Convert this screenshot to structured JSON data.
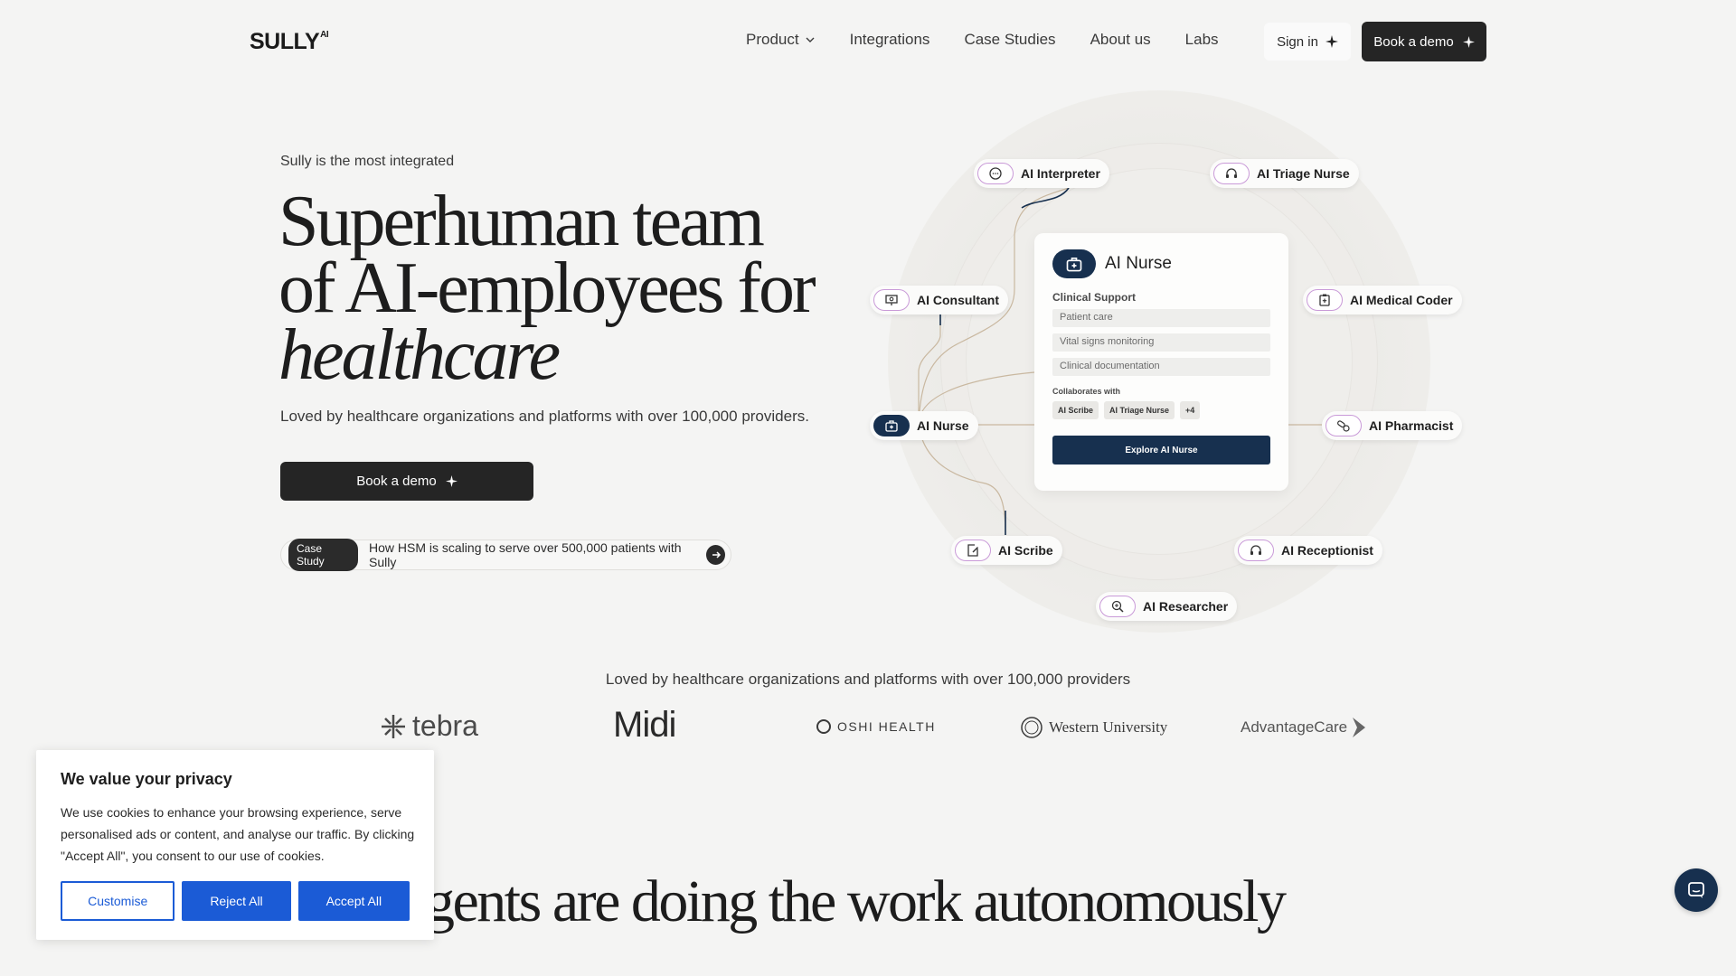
{
  "brand": {
    "logo_text": "SULLY",
    "logo_sup": "AI"
  },
  "nav": {
    "links": [
      "Product",
      "Integrations",
      "Case Studies",
      "About us",
      "Labs"
    ],
    "sign_in": "Sign in",
    "book_demo": "Book a demo"
  },
  "hero": {
    "eyebrow": "Sully is the most integrated",
    "headline_line1": "Superhuman team",
    "headline_line2": "of AI-employees for",
    "headline_line3": "healthcare",
    "subline": "Loved by healthcare organizations and platforms with over 100,000 providers.",
    "cta": "Book a demo",
    "case_badge": "Case Study",
    "case_text": "How HSM is scaling to serve over 500,000 patients with Sully"
  },
  "agents": {
    "interpreter": "AI Interpreter",
    "triage": "AI Triage Nurse",
    "consultant": "AI Consultant",
    "medical_coder": "AI Medical Coder",
    "nurse": "AI Nurse",
    "pharmacist": "AI Pharmacist",
    "scribe": "AI Scribe",
    "receptionist": "AI Receptionist",
    "researcher": "AI Researcher"
  },
  "nurse_card": {
    "title": "AI Nurse",
    "section_label": "Clinical Support",
    "items": [
      "Patient care",
      "Vital signs monitoring",
      "Clinical documentation"
    ],
    "collab_label": "Collaborates with",
    "collab": [
      "AI Scribe",
      "AI Triage Nurse",
      "+4"
    ],
    "button": "Explore AI Nurse"
  },
  "logos": {
    "caption": "Loved by healthcare organizations and platforms with over 100,000 providers",
    "items": [
      "tebra",
      "Midi",
      "OSHI HEALTH",
      "Western University",
      "AdvantageCare"
    ]
  },
  "section": {
    "headline": "gents are doing the work autonomously"
  },
  "cookie": {
    "title": "We value your privacy",
    "text": "We use cookies to enhance your browsing experience, serve personalised ads or content, and analyse our traffic. By clicking \"Accept All\", you consent to our use of cookies.",
    "customise": "Customise",
    "reject": "Reject All",
    "accept": "Accept All"
  },
  "colors": {
    "navy": "#17304f",
    "cookie_blue": "#1b5bd6",
    "dark_button": "#252525"
  }
}
